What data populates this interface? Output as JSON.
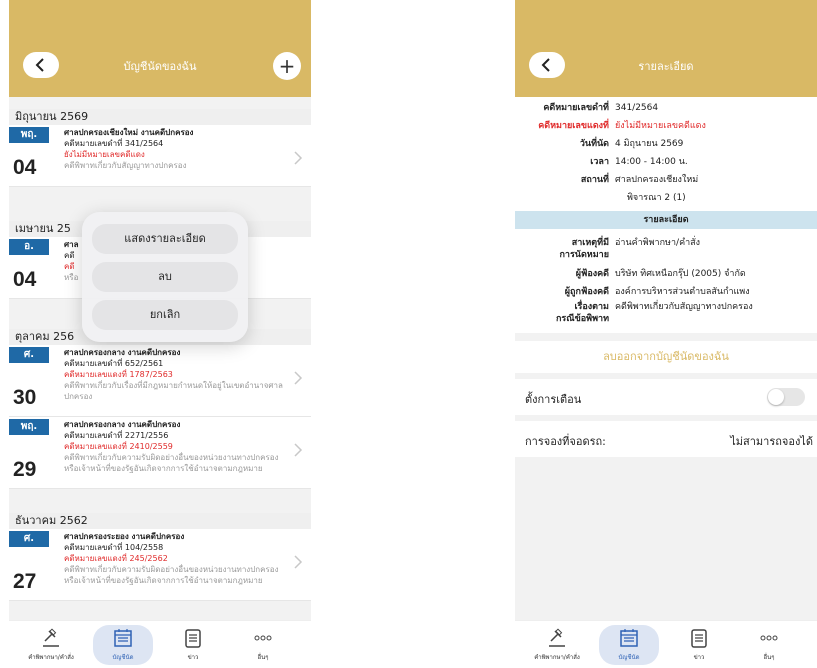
{
  "left": {
    "header": {
      "title": "บัญชีนัดของฉัน",
      "add_label": "+"
    },
    "groups": [
      {
        "month": "มิถุนายน 2569",
        "items": [
          {
            "day": "พฤ.",
            "date": "04",
            "court": "ศาลปกครองเชียงใหม่ งานคดีปกครอง",
            "black": "คดีหมายเลขดำที่ 341/2564",
            "red": "ยังไม่มีหมายเลขคดีแดง",
            "desc": "คดีพิพาทเกี่ยวกับสัญญาทางปกครอง"
          }
        ]
      },
      {
        "month": "เมษายน 25",
        "items": [
          {
            "day": "อ.",
            "date": "04",
            "court": "ศาล",
            "black": "คดี",
            "red": "คดี",
            "desc": "หรือ"
          }
        ]
      },
      {
        "month": "ตุลาคม 256",
        "items": [
          {
            "day": "ศ.",
            "date": "30",
            "court": "ศาลปกครองกลาง งานคดีปกครอง",
            "black": "คดีหมายเลขดำที่ 652/2561",
            "red": "คดีหมายเลขแดงที่ 1787/2563",
            "desc": "คดีพิพาทเกี่ยวกับเรื่องที่มีกฎหมายกำหนดให้อยู่ในเขตอำนาจศาลปกครอง"
          },
          {
            "day": "พฤ.",
            "date": "29",
            "court": "ศาลปกครองกลาง งานคดีปกครอง",
            "black": "คดีหมายเลขดำที่ 2271/2556",
            "red": "คดีหมายเลขแดงที่ 2410/2559",
            "desc": "คดีพิพาทเกี่ยวกับความรับผิดอย่างอื่นของหน่วยงานทางปกครองหรือเจ้าหน้าที่ของรัฐอันเกิดจากการใช้อำนาจตามกฎหมาย"
          }
        ]
      },
      {
        "month": "ธันวาคม 2562",
        "items": [
          {
            "day": "ศ.",
            "date": "27",
            "court": "ศาลปกครองระยอง งานคดีปกครอง",
            "black": "คดีหมายเลขดำที่ 104/2558",
            "red": "คดีหมายเลขแดงที่ 245/2562",
            "desc": "คดีพิพาทเกี่ยวกับความรับผิดอย่างอื่นของหน่วยงานทางปกครองหรือเจ้าหน้าที่ของรัฐอันเกิดจากการใช้อำนาจตามกฎหมาย"
          }
        ]
      }
    ],
    "popup": {
      "show_detail": "แสดงรายละเอียด",
      "delete": "ลบ",
      "cancel": "ยกเลิก"
    }
  },
  "right": {
    "header": {
      "title": "รายละเอียด"
    },
    "info": {
      "black_label": "คดีหมายเลขดำที่",
      "black_value": "341/2564",
      "red_label": "คดีหมายเลขแดงที่",
      "red_value": "ยังไม่มีหมายเลขคดีแดง",
      "date_label": "วันที่นัด",
      "date_value": "4 มิถุนายน 2569",
      "time_label": "เวลา",
      "time_value": "14:00 - 14:00 น.",
      "place_label": "สถานที่",
      "place_value": "ศาลปกครองเชียงใหม่",
      "room_value": "พิจารณา 2 (1)"
    },
    "section_title": "รายละเอียด",
    "detail": {
      "reason_label_1": "สาเหตุที่มี",
      "reason_label_2": "การนัดหมาย",
      "reason_value": "อ่านคำพิพากษา/คำสั่ง",
      "plaintiff_label": "ผู้ฟ้องคดี",
      "plaintiff_value": "บริษัท ทิศเหนือกรุ๊ป (2005) จำกัด",
      "defendant_label": "ผู้ถูกฟ้องคดี",
      "defendant_value": "องค์การบริหารส่วนตำบลสันกำแพง",
      "matter_label_1": "เรื่องตาม",
      "matter_label_2": "กรณีข้อพิพาท",
      "matter_value": "คดีพิพาทเกี่ยวกับสัญญาทางปกครอง"
    },
    "remove_label": "ลบออกจากบัญชีนัดของฉัน",
    "alert_label": "ตั้งการเตือน",
    "parking_label": "การจองที่จอดรถ:",
    "parking_value": "ไม่สามารถจองได้"
  },
  "tabs": [
    {
      "label": "คำพิพากษา/คำสั่ง",
      "icon": "gavel-icon"
    },
    {
      "label": "บัญชีนัด",
      "icon": "calendar-icon"
    },
    {
      "label": "ข่าว",
      "icon": "news-icon"
    },
    {
      "label": "อื่นๆ",
      "icon": "more-icon"
    }
  ],
  "colors": {
    "accent": "#d9b965",
    "day_tag": "#1f69a6",
    "red": "#e02a2a",
    "section": "#cde3ee",
    "active_tab": "#dde5f3"
  }
}
